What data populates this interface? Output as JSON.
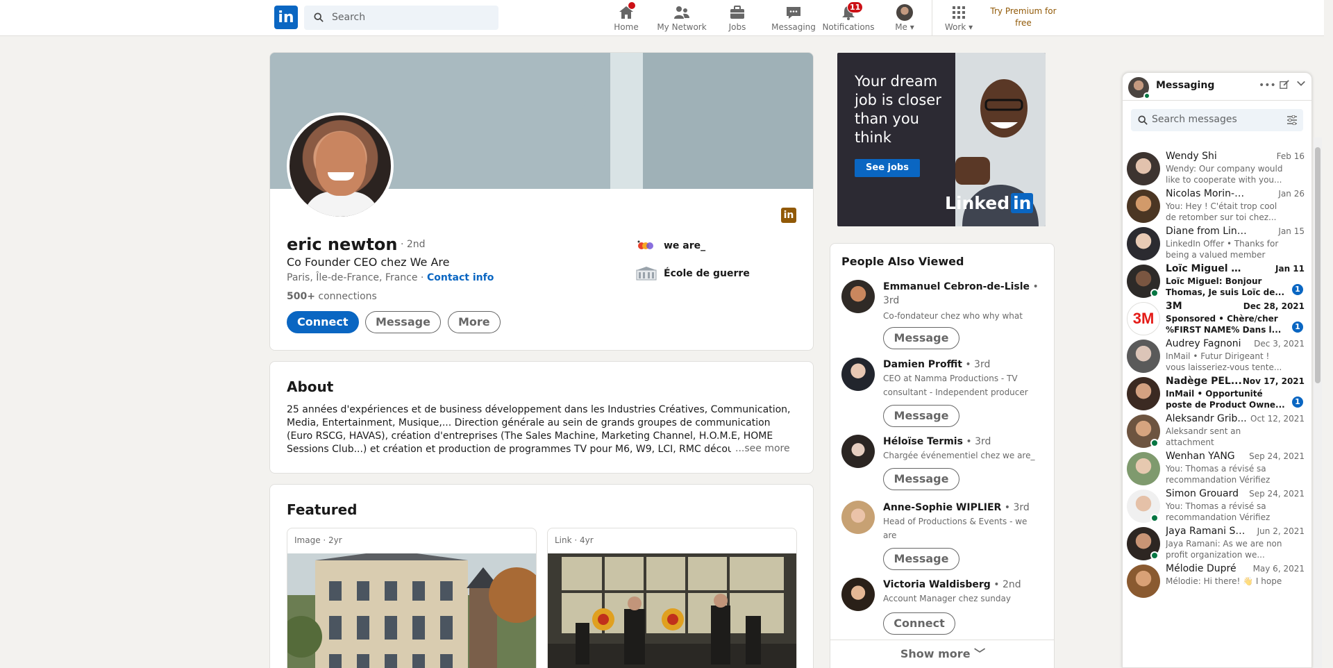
{
  "nav": {
    "search_placeholder": "Search",
    "items": [
      {
        "label": "Home",
        "icon": "home-icon"
      },
      {
        "label": "My Network",
        "icon": "people-icon"
      },
      {
        "label": "Jobs",
        "icon": "briefcase-icon"
      },
      {
        "label": "Messaging",
        "icon": "chat-icon"
      },
      {
        "label": "Notifications",
        "icon": "bell-icon",
        "badge": "11"
      },
      {
        "label": "Me",
        "icon": "avatar"
      },
      {
        "label": "Work",
        "icon": "grid-icon"
      }
    ],
    "premium": "Try Premium for free",
    "logo": "in"
  },
  "profile": {
    "name": "eric newton",
    "degree": "· 2nd",
    "headline": "Co Founder CEO chez We Are",
    "location": "Paris, Île-de-France, France ·",
    "contact": "Contact info",
    "connections_count": "500+",
    "connections_label": "connections",
    "buttons": {
      "connect": "Connect",
      "message": "Message",
      "more": "More"
    },
    "orgs": [
      {
        "name": "we are_"
      },
      {
        "name": "École de guerre"
      }
    ],
    "logo_badge": "in"
  },
  "about": {
    "title": "About",
    "text": "25 années d'expériences et de business développement dans les Industries Créatives, Communication, Media, Entertainment, Musique,... Direction générale au sein de grands groupes de communication (Euro RSCG, HAVAS), création d'entreprises (The Sales Machine, Marketing Channel, H.O.M.E, HOME Sessions Club...) et création et production de programmes TV pour M6, W9, LCI, RMC découverte...",
    "see_more": "...see more"
  },
  "featured": {
    "title": "Featured",
    "items": [
      {
        "type": "Image · 2yr"
      },
      {
        "type": "Link · 4yr"
      }
    ]
  },
  "ad": {
    "text": "Your dream job is closer than you think",
    "button": "See jobs",
    "brand": "Linked",
    "brand_in": "in"
  },
  "pav": {
    "title": "People Also Viewed",
    "people": [
      {
        "name": "Emmanuel Cebron-de-Lisle",
        "degree": "• 3rd",
        "headline": "Co-fondateur chez who why what",
        "action": "Message"
      },
      {
        "name": "Damien Proffit",
        "degree": "• 3rd",
        "headline": "CEO at Namma Productions - TV consultant - Independent producer",
        "action": "Message"
      },
      {
        "name": "Héloïse Termis",
        "degree": "• 3rd",
        "headline": "Chargée événementiel chez we are_",
        "action": "Message"
      },
      {
        "name": "Anne-Sophie WIPLIER",
        "degree": "• 3rd",
        "headline": "Head of Productions & Events - we are",
        "action": "Message"
      },
      {
        "name": "Victoria Waldisberg",
        "degree": "• 2nd",
        "headline": "Account Manager chez sunday",
        "action": "Connect"
      }
    ],
    "show_more": "Show more ﹀"
  },
  "messaging": {
    "title": "Messaging",
    "search_placeholder": "Search messages",
    "conversations": [
      {
        "name": "Wendy Shi",
        "date": "Feb 16",
        "snippet": "Wendy: Our company would like to cooperate with you...",
        "unread": false,
        "online": false
      },
      {
        "name": "Nicolas Morin-Forest",
        "date": "Jan 26",
        "snippet": "You: Hey ! C'était trop cool de retomber sur toi chez...",
        "unread": false,
        "online": false
      },
      {
        "name": "Diane from LinkedIn ...",
        "date": "Jan 15",
        "snippet": "LinkedIn Offer • Thanks for being a valued member",
        "unread": false,
        "online": false
      },
      {
        "name": "Loïc Miguel NAVA...",
        "date": "Jan 11",
        "snippet": "Loïc Miguel: Bonjour Thomas, Je suis Loïc de...",
        "unread": true,
        "online": true,
        "count": "1"
      },
      {
        "name": "3M",
        "date": "Dec 28, 2021",
        "snippet": "Sponsored • Chère/cher %FIRST NAME% Dans l...",
        "unread": true,
        "online": false,
        "count": "1"
      },
      {
        "name": "Audrey Fagnoni",
        "date": "Dec 3, 2021",
        "snippet": "InMail • Futur Dirigeant ! vous laisseriez-vous tente...",
        "unread": false,
        "online": false
      },
      {
        "name": "Nadège PEL...",
        "date": "Nov 17, 2021",
        "snippet": "InMail • Opportunité poste de Product Owne...",
        "unread": true,
        "online": false,
        "count": "1"
      },
      {
        "name": "Aleksandr Grib...",
        "date": "Oct 12, 2021",
        "snippet": "Aleksandr sent an attachment",
        "unread": false,
        "online": true
      },
      {
        "name": "Wenhan YANG",
        "date": "Sep 24, 2021",
        "snippet": "You: Thomas a révisé sa recommandation Vérifiez la...",
        "unread": false,
        "online": false
      },
      {
        "name": "Simon Grouard",
        "date": "Sep 24, 2021",
        "snippet": "You: Thomas a révisé sa recommandation Vérifiez la...",
        "unread": false,
        "online": true
      },
      {
        "name": "Jaya Ramani Sa...",
        "date": "Jun 2, 2021",
        "snippet": "Jaya Ramani: As we are non profit organization we...",
        "unread": false,
        "online": true
      },
      {
        "name": "Mélodie Dupré",
        "date": "May 6, 2021",
        "snippet": "Mélodie: Hi there! 👋 I hope",
        "unread": false,
        "online": false
      }
    ]
  },
  "colors": {
    "brand": "#0a66c2",
    "premium": "#915907",
    "badge": "#cc1016",
    "online": "#057642"
  }
}
